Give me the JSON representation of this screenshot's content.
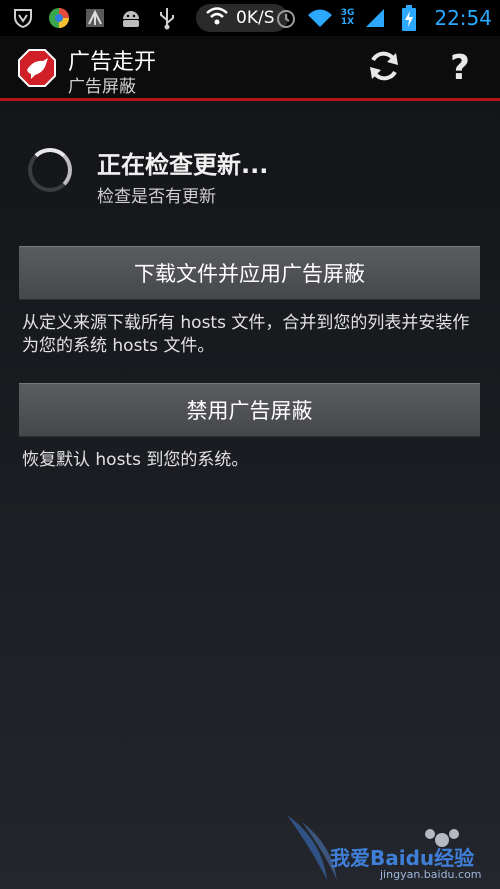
{
  "status_bar": {
    "network_speed": "0K/S",
    "net_type_top": "3G",
    "net_type_bottom": "1X",
    "time": "22:54",
    "icons": [
      "shield-v-icon",
      "colorful-app-icon",
      "antenna-icon",
      "android-icon",
      "usb-icon",
      "wifi-icon",
      "alarm-icon",
      "wifi-icon",
      "signal-icon",
      "battery-charging-icon"
    ]
  },
  "action_bar": {
    "title": "广告走开",
    "subtitle": "广告屏蔽",
    "refresh_icon": "refresh-icon",
    "help_label": "?"
  },
  "status": {
    "title": "正在检查更新...",
    "subtitle": "检查是否有更新"
  },
  "actions": {
    "download_label": "下载文件并应用广告屏蔽",
    "download_desc": "从定义来源下载所有 hosts 文件，合并到您的列表并安装作为您的系统 hosts 文件。",
    "disable_label": "禁用广告屏蔽",
    "disable_desc": "恢复默认 hosts 到您的系统。"
  },
  "watermark": {
    "text": "我爱Baidu经验",
    "url": "jingyan.baidu.com"
  },
  "colors": {
    "accent_red": "#b3141b",
    "clock_blue": "#29a9ff"
  }
}
